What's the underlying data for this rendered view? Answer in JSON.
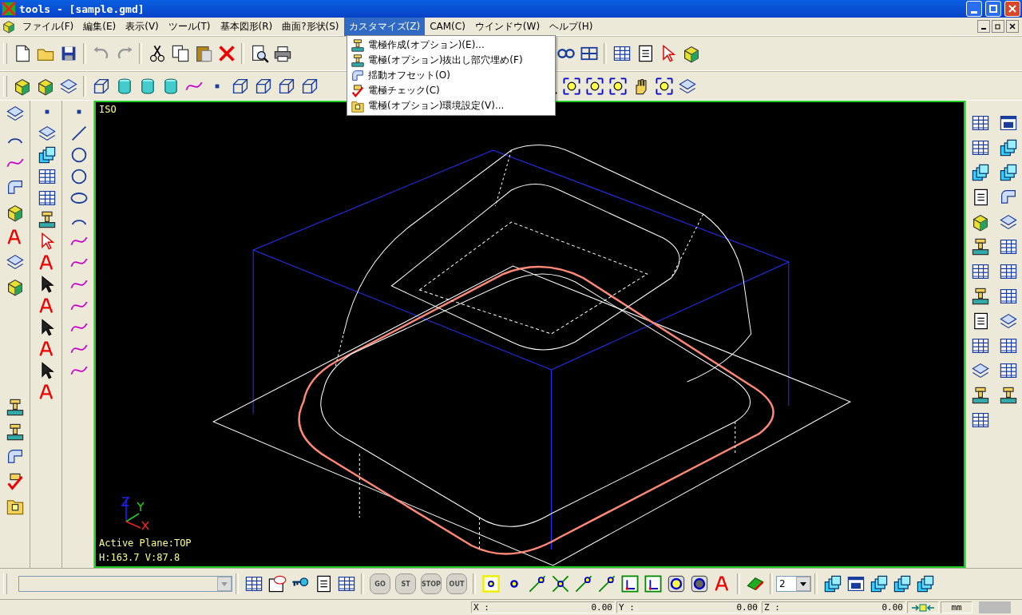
{
  "window": {
    "title": "tools - [sample.gmd]"
  },
  "menu": [
    {
      "label": "ファイル(F)",
      "selected": false
    },
    {
      "label": "編集(E)",
      "selected": false
    },
    {
      "label": "表示(V)",
      "selected": false
    },
    {
      "label": "ツール(T)",
      "selected": false
    },
    {
      "label": "基本図形(R)",
      "selected": false
    },
    {
      "label": "曲面?形状(S)",
      "selected": false
    },
    {
      "label": "カスタマイズ(Z)",
      "selected": true
    },
    {
      "label": "CAM(C)",
      "selected": false
    },
    {
      "label": "ウインドウ(W)",
      "selected": false
    },
    {
      "label": "ヘルプ(H)",
      "selected": false
    }
  ],
  "dropdown": [
    {
      "label": "電極作成(オプション)(E)..."
    },
    {
      "label": "電極(オプション)抜出し部穴埋め(F)"
    },
    {
      "label": "揺動オフセット(O)"
    },
    {
      "label": "電極チェック(C)"
    },
    {
      "label": "電極(オプション)環境設定(V)..."
    }
  ],
  "viewport": {
    "view_name": "ISO",
    "active_plane": "Active Plane:TOP",
    "hv": "H:163.7 V:87.8"
  },
  "bottom_toolbar": {
    "run_buttons": [
      {
        "label": "GO",
        "disabled": true
      },
      {
        "label": "ST",
        "disabled": true
      },
      {
        "label": "STOP",
        "disabled": true
      },
      {
        "label": "OUT",
        "disabled": true
      }
    ],
    "layer_select": "2"
  },
  "status_bar": {
    "coords": [
      {
        "axis": "X :",
        "value": "0.00"
      },
      {
        "axis": "Y :",
        "value": "0.00"
      },
      {
        "axis": "Z :",
        "value": "0.00"
      }
    ],
    "unit": "mm"
  }
}
